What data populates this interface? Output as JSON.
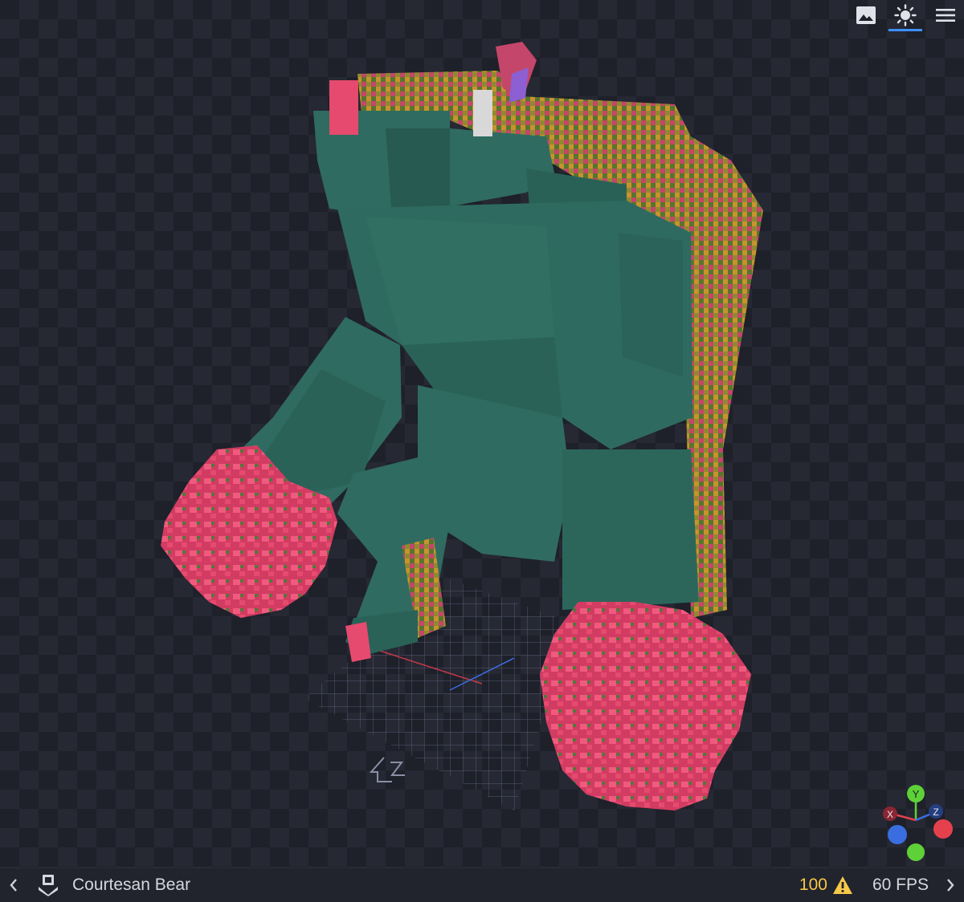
{
  "toolbar": {
    "items": [
      {
        "name": "image-icon",
        "active": false
      },
      {
        "name": "sun-icon",
        "active": true
      },
      {
        "name": "menu-icon",
        "active": false
      }
    ]
  },
  "gizmo": {
    "y_label": "Y",
    "x_label": "X",
    "z_label": "Z",
    "colors": {
      "x": "#e5414d",
      "y": "#5ed038",
      "z": "#3a6ee0"
    }
  },
  "statusbar": {
    "model_name": "Courtesan Bear",
    "warning_count": "100",
    "fps": "60 FPS"
  },
  "colors": {
    "body": "#2e6a5f",
    "fur_pink": "#e64a6e",
    "accent_blue": "#3e90ff",
    "warning": "#f7c948"
  }
}
